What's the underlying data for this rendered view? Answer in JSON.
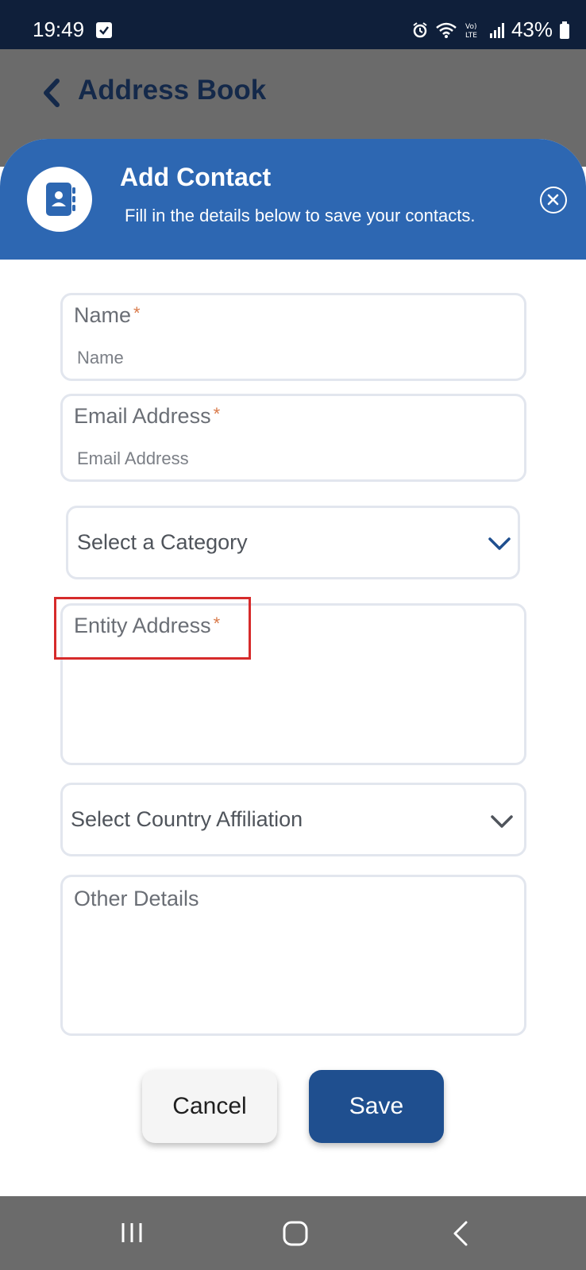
{
  "status_bar": {
    "time": "19:49",
    "battery": "43%"
  },
  "header": {
    "title": "Address Book"
  },
  "modal": {
    "title": "Add Contact",
    "subtitle": "Fill in the details below to save your contacts."
  },
  "form": {
    "name": {
      "label": "Name",
      "required_mark": "*",
      "placeholder": "Name"
    },
    "email": {
      "label": "Email Address",
      "required_mark": "*",
      "placeholder": "Email Address"
    },
    "category": {
      "value": "Select a Category"
    },
    "entity_address": {
      "label": "Entity Address",
      "required_mark": "*"
    },
    "country": {
      "value": "Select Country Affiliation"
    },
    "other_details": {
      "label": "Other Details"
    }
  },
  "buttons": {
    "cancel": "Cancel",
    "save": "Save"
  },
  "colors": {
    "status_bar": "#0f1f3a",
    "modal_header": "#2d67b2",
    "primary_button": "#1f4f8f",
    "required": "#d97a4a",
    "highlight": "#d62b2b"
  },
  "icons": [
    "checkbox-icon",
    "alarm-icon",
    "wifi-icon",
    "volte-icon",
    "signal-icon",
    "battery-icon",
    "back-arrow-icon",
    "contact-book-icon",
    "close-icon",
    "chevron-down-icon",
    "recents-icon",
    "home-icon",
    "nav-back-icon"
  ]
}
